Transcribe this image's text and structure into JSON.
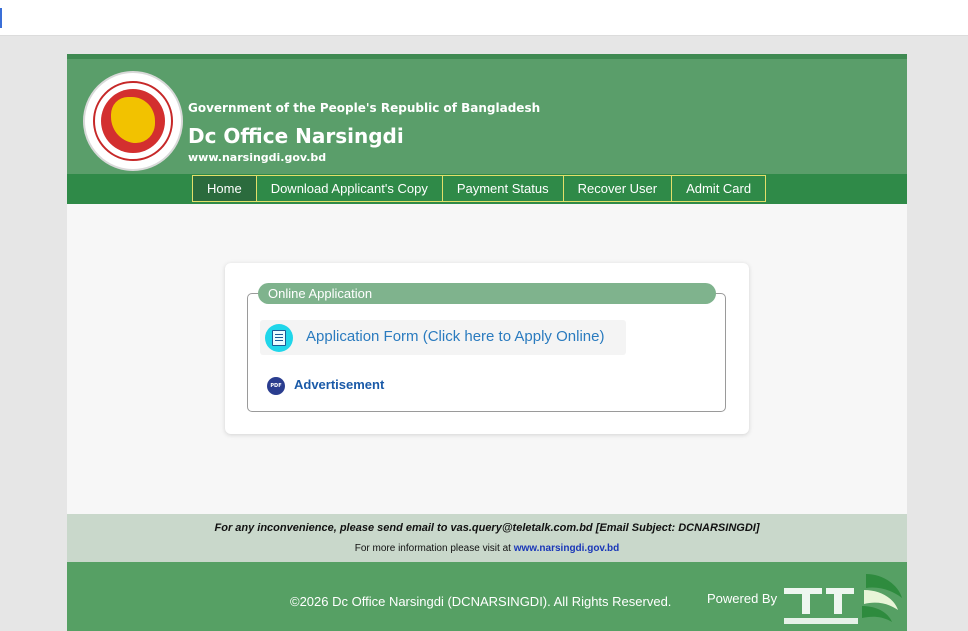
{
  "header": {
    "government_line": "Government of the People's Republic of Bangladesh",
    "site_title": "Dc Office Narsingdi",
    "site_url": "www.narsingdi.gov.bd",
    "seal_icon": "bangladesh-government-seal-icon"
  },
  "nav": {
    "items": [
      {
        "label": "Home",
        "active": true
      },
      {
        "label": "Download Applicant's Copy"
      },
      {
        "label": "Payment Status"
      },
      {
        "label": "Recover User"
      },
      {
        "label": "Admit Card"
      }
    ]
  },
  "main": {
    "section_title": "Online Application",
    "application_form_label": "Application Form (Click here to Apply Online)",
    "application_form_icon": "document-form-icon",
    "advertisement_label": "Advertisement",
    "advertisement_icon": "pdf-icon"
  },
  "info_strip": {
    "line1": "For any inconvenience, please send email to vas.query@teletalk.com.bd [Email Subject: DCNARSINGDI]",
    "line2_prefix": "For more information please visit at ",
    "line2_link": "www.narsingdi.gov.bd"
  },
  "footer": {
    "copyright": "©2026 Dc Office Narsingdi (DCNARSINGDI). All Rights Reserved.",
    "powered_by": "Powered By",
    "logo_icon": "teletalk-logo-icon"
  },
  "colors": {
    "header_green": "#5a9e6a",
    "nav_green": "#2f8a48",
    "nav_border": "#e3df6a",
    "legend_green": "#7fb38d",
    "link_blue": "#2a7bbf"
  }
}
